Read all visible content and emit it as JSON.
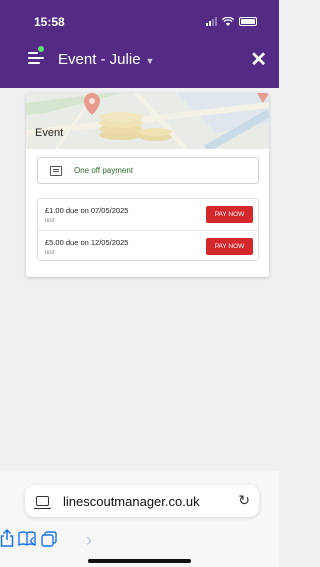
{
  "status_bar": {
    "time": "15:58"
  },
  "header": {
    "title": "Event - Julie"
  },
  "card": {
    "title": "Event",
    "payment_type": "One off payment",
    "payments": [
      {
        "label": "£1.00 due on 07/05/2025",
        "note": "test",
        "button": "PAY NOW"
      },
      {
        "label": "£5.00 due on 12/05/2025",
        "note": "test",
        "button": "PAY NOW"
      }
    ]
  },
  "browser": {
    "url": "linescoutmanager.co.uk"
  },
  "colors": {
    "header_bg": "#532b84",
    "pay_button": "#d4282d",
    "link_blue": "#1a74e4",
    "notification_dot": "#5ee36d"
  }
}
